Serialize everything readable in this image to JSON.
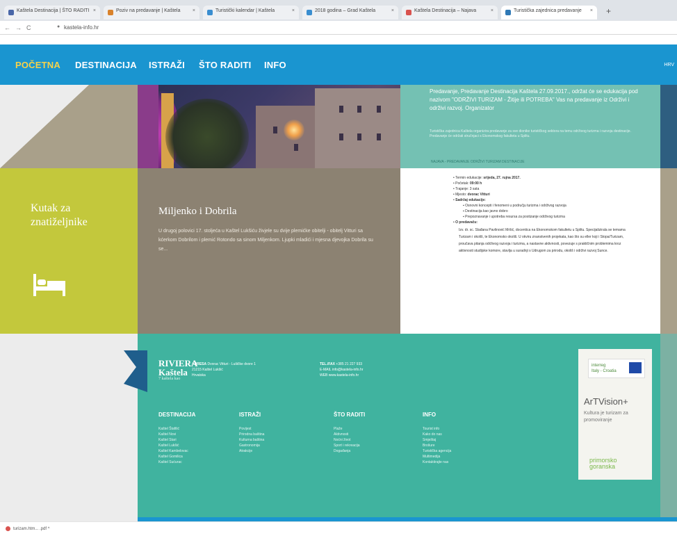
{
  "browser": {
    "tabs": [
      {
        "label": "Kaštela Destinacija | ŠTO RADITI",
        "color": "#4a67a8"
      },
      {
        "label": "Poziv na predavanje | Kaštela",
        "color": "#d9822b"
      },
      {
        "label": "Turistički kalendar | Kaštela",
        "color": "#3a8ed0"
      },
      {
        "label": "2018 godina – Grad Kaštela",
        "color": "#3a8ed0"
      },
      {
        "label": "Kaštela Destinacija – Najava",
        "color": "#d9534f"
      },
      {
        "label": "Turistička zajednica predavanje",
        "color": "#2f79b6"
      }
    ],
    "new_tab": "+",
    "url": "kastela-info.hr"
  },
  "nav": {
    "items": [
      "POČETNA",
      "DESTINACIJA",
      "ISTRAŽI",
      "ŠTO RADITI",
      "INFO"
    ],
    "active_index": 0,
    "right_label": "HRV"
  },
  "hero": {
    "teal_text": "Predavanje, Predavanje Destinacija Kaštela 27.09.2017., održat će se edukacija pod nazivom \"ODRŽIVI TURIZAM - Žitije ili POTREBA\" Vas na predavanje iz Održivi i održivi razvoj. Organizator",
    "teal_small": "Turistička zajednica Kaštela organizira predavanje za sve dionike turističkog sektora na temu održivog turizma i razvoja destinacije. Predavanje će održati stručnjaci s Ekonomskog fakulteta u Splitu.",
    "teal_link": "NAJAVA - PREDAVANJE ODRŽIVI TURIZAM DESTINACIJE"
  },
  "kutak": {
    "title": "Kutak za\nznatiželjnike",
    "icon": "bed-icon"
  },
  "miljenko": {
    "title": "Miljenko i Dobrila",
    "text": "U drugoj polovici 17. stoljeća u Kaštel Lukšiću živjele su dvije plemićke obitelji - obitelj Vitturi sa kćerkom Dobrilom i plemić Rotondo sa sinom Miljenkom. Ljupki mladići i mjesna djevojka Dobrila su se..."
  },
  "info_panel": {
    "items": [
      {
        "label": "Termin edukacije: ",
        "value": "srijeda, 27. rujna 2017."
      },
      {
        "label": "Početak: ",
        "value": "09:00 h"
      },
      {
        "label": "Trajanje: ",
        "value": "3 sata"
      },
      {
        "label": "Mjesto: ",
        "value": "dvorac Vitturi"
      }
    ],
    "sadrzaj_label": "Sadržaj edukacije:",
    "sadrzaj": [
      "Osnovni koncepti i fenomeni u području turizma i održivog razvoja",
      "Destinacija kao javno dobro",
      "Prepoznavanje i upotreba resursa za postizanje održivog turizma"
    ],
    "predavac_label": "O predavaču:",
    "predavac_text": "Izv. dr. sc. Slađana Pavlinović Mršić, docentica na Ekonomskom fakultetu u Splitu. Specijalizirala se temama Turizam i okoliš, te Ekonomsko okoliš. U okviru znanstvenih projekata, kao što su eller koji i Stopa/Turizam, proučava pitanja održivog razvoja i turizma, a nastavne aktivnosti, povezuje s praktičnim problemima kroz aktivnosti studijske komore, stavlja u suradnji s Udrugom za prirodu, okoliš i održivi razvoj Sunce."
  },
  "footer": {
    "logo_a": "RIVIERA\nKaštela",
    "logo_b": "7 kaštela kao",
    "contact1_label": "ADRESA",
    "contact1": "Dvorac Vitturi - Lušičke dvore 1\n21215 Kaštel Lukšić\nHrvatska",
    "contact2_label": "TEL./FAX",
    "contact2": "+385 21 227 933\nE-MAIL info@kastela-info.hr\nWEB www.kastela-info.hr",
    "columns": [
      {
        "heading": "DESTINACIJA",
        "links": [
          "Kaštel Štafilić",
          "Kaštel Novi",
          "Kaštel Stari",
          "Kaštel Lukšić",
          "Kaštel Kambelovac",
          "Kaštel Gomilica",
          "Kaštel Sućurac"
        ]
      },
      {
        "heading": "ISTRAŽI",
        "links": [
          "Povijest",
          "Prirodna baština",
          "Kulturna baština",
          "Gastronomija",
          "Atrakcije"
        ]
      },
      {
        "heading": "ŠTO RADITI",
        "links": [
          "Plaže",
          "Aktivnosti",
          "Noćni život",
          "Sport i rekreacija",
          "Događanja"
        ]
      },
      {
        "heading": "INFO",
        "links": [
          "Tourist info",
          "Kako do nas",
          "Smještaj",
          "Brošure",
          "Turistička agencija",
          "Multimedija",
          "Kontaktirajte nas"
        ]
      }
    ],
    "ad": {
      "interreg": "interreg\nItaly - Croatia",
      "title": "ArTVision+",
      "subtitle": "Kultura je turizam za promoviranje",
      "brand": "primorsko\ngoranska"
    }
  },
  "status": {
    "download": "turizam.htm...  .pdf   ^"
  }
}
